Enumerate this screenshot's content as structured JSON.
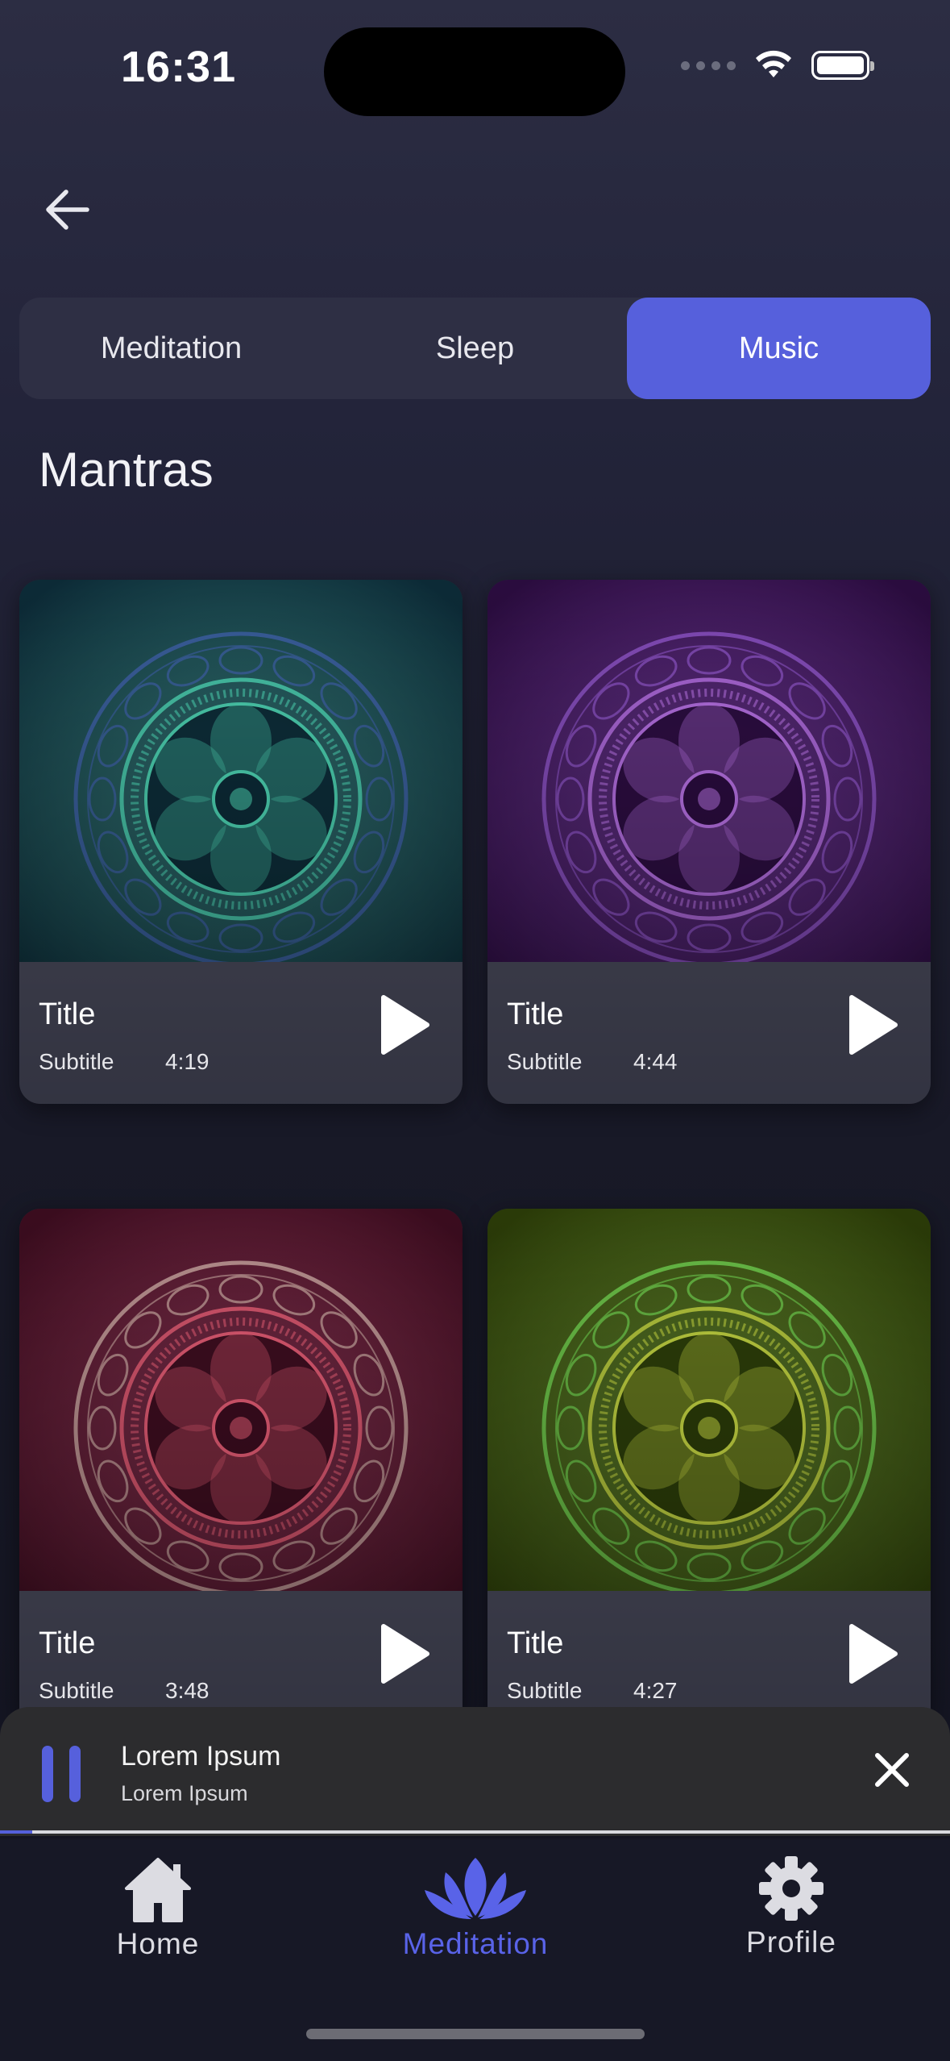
{
  "status": {
    "time": "16:31"
  },
  "tabs": [
    {
      "label": "Meditation",
      "active": false
    },
    {
      "label": "Sleep",
      "active": false
    },
    {
      "label": "Music",
      "active": true
    }
  ],
  "section": {
    "title": "Mantras"
  },
  "cards": [
    {
      "title": "Title",
      "subtitle": "Subtitle",
      "duration": "4:19",
      "colors": {
        "bg": "#0c2a36",
        "glow": "#2f8f86",
        "ring": "#3e5fa8",
        "inner": "#4bd0b0"
      }
    },
    {
      "title": "Title",
      "subtitle": "Subtitle",
      "duration": "4:44",
      "colors": {
        "bg": "#2a0c3e",
        "glow": "#7a2fa8",
        "ring": "#8e55c8",
        "inner": "#b46fe0"
      }
    },
    {
      "title": "Title",
      "subtitle": "Subtitle",
      "duration": "3:48",
      "colors": {
        "bg": "#3a0c1e",
        "glow": "#a02a4c",
        "ring": "#c8a8a0",
        "inner": "#e05a72"
      }
    },
    {
      "title": "Title",
      "subtitle": "Subtitle",
      "duration": "4:27",
      "colors": {
        "bg": "#2a3a08",
        "glow": "#6a9a18",
        "ring": "#6fd050",
        "inner": "#c0d040"
      }
    }
  ],
  "player": {
    "title": "Lorem Ipsum",
    "subtitle": "Lorem Ipsum",
    "progress": 0.034,
    "accent": "#5660dc"
  },
  "bottom_nav": [
    {
      "label": "Home",
      "icon": "home-icon",
      "active": false
    },
    {
      "label": "Meditation",
      "icon": "lotus-icon",
      "active": true
    },
    {
      "label": "Profile",
      "icon": "gear-icon",
      "active": false
    }
  ]
}
